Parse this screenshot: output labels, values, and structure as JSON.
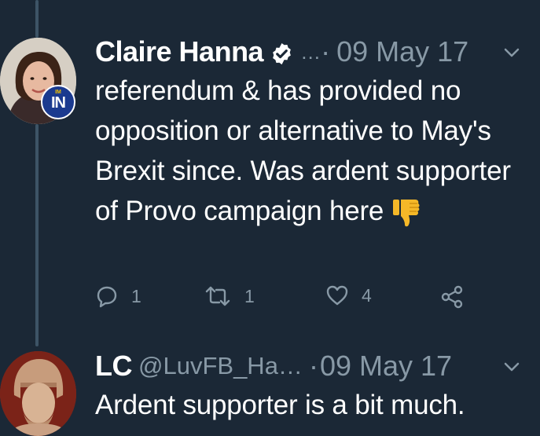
{
  "tweets": [
    {
      "name": "Claire Hanna",
      "handle": "…",
      "dot": "·",
      "date": "09 May 17",
      "verified": true,
      "avatar_badge": {
        "top": "IM",
        "main": "IN"
      },
      "text": "referendum & has provided no opposition or alternative to May's Brexit since. Was ardent supporter of Provo campaign here",
      "emoji": "thumbs-down",
      "actions": {
        "replies": "1",
        "retweets": "1",
        "likes": "4"
      }
    },
    {
      "name": "LC",
      "handle": "@LuvFB_Ha…",
      "dot": "·",
      "date": "09 May 17",
      "verified": false,
      "text": "Ardent supporter is a bit much."
    }
  ],
  "icons": [
    "verified-badge-icon",
    "chevron-down-icon",
    "reply-icon",
    "retweet-icon",
    "heart-icon",
    "share-icon",
    "thumbs-down-emoji"
  ],
  "colors": {
    "background": "#1b2836",
    "muted": "#8899a6",
    "text": "#ffffff",
    "thread_line": "#3d5466",
    "emoji": "#f5b828"
  }
}
